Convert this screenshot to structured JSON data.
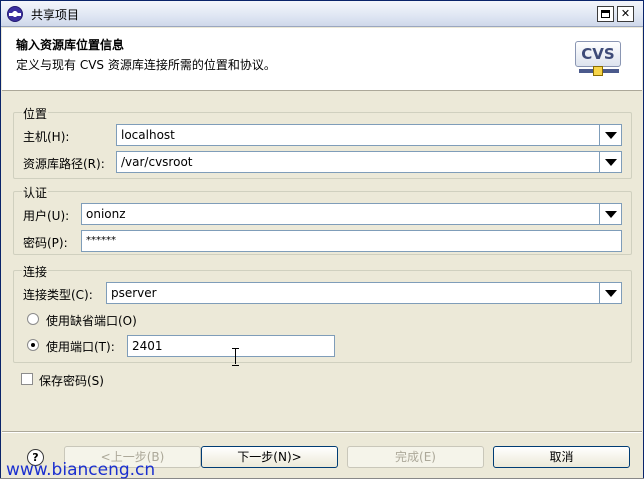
{
  "window": {
    "title": "共享项目"
  },
  "header": {
    "title": "输入资源库位置信息",
    "description": "定义与现有 CVS 资源库连接所需的位置和协议。",
    "logo_text": "CVS"
  },
  "location": {
    "group_label": "位置",
    "host_label": "主机(H):",
    "host_value": "localhost",
    "path_label": "资源库路径(R):",
    "path_value": "/var/cvsroot"
  },
  "auth": {
    "group_label": "认证",
    "user_label": "用户(U):",
    "user_value": "onionz",
    "password_label": "密码(P):",
    "password_value": "******"
  },
  "connection": {
    "group_label": "连接",
    "type_label": "连接类型(C):",
    "type_value": "pserver",
    "default_port_label": "使用缺省端口(O)",
    "use_port_label": "使用端口(T):",
    "port_value": "2401",
    "selected": "use_port"
  },
  "save_password_label": "保存密码(S)",
  "buttons": {
    "help": "?",
    "back": "<上一步(B)",
    "next": "下一步(N)>",
    "finish": "完成(E)",
    "cancel": "取消"
  },
  "watermark": "www.bianceng.cn",
  "colors": {
    "title_bar": "#dfe6f3",
    "dialog_bg": "#ece9d8",
    "field_border": "#7f9db9",
    "watermark": "#1a2fd0"
  }
}
